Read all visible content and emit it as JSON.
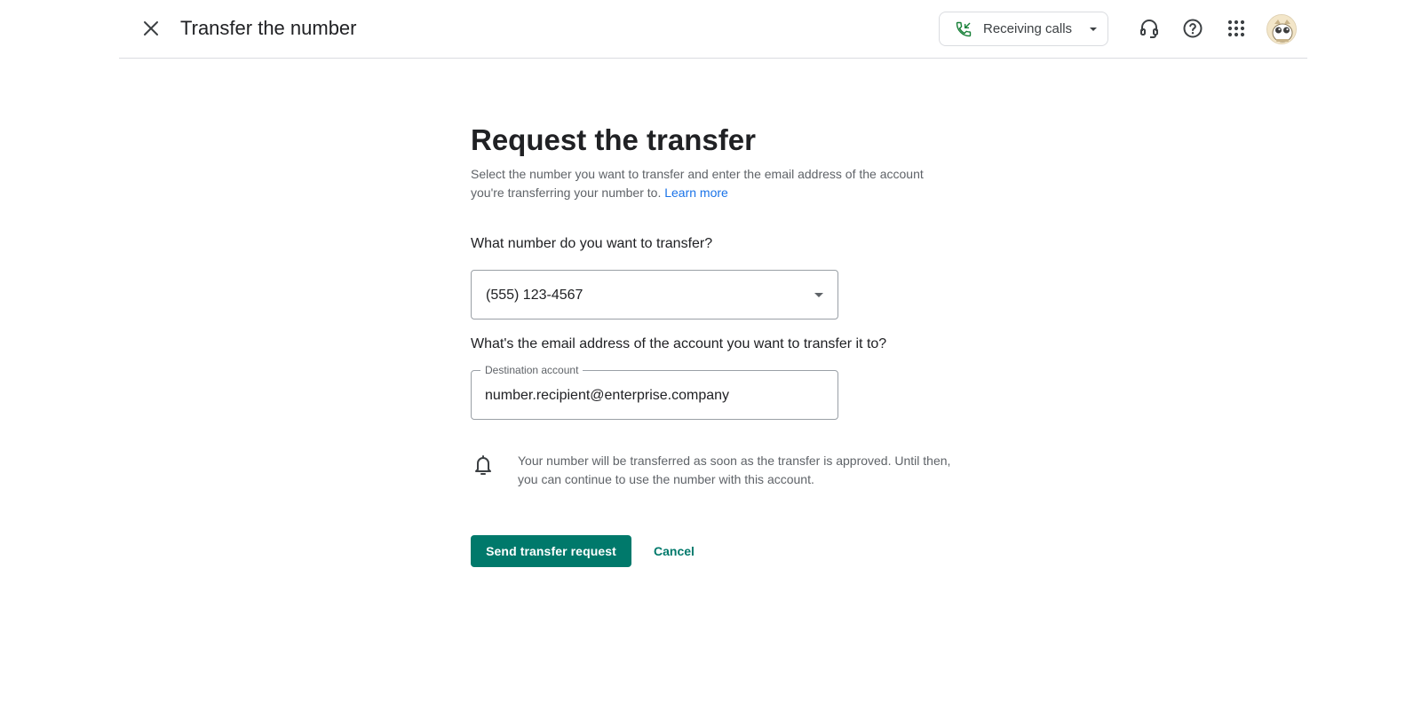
{
  "header": {
    "title": "Transfer the number",
    "close_icon": "close-icon",
    "status_chip": {
      "label": "Receiving calls",
      "icon": "phone-incoming-icon",
      "accent": "#188038"
    },
    "icons": [
      "headset-icon",
      "help-icon",
      "apps-grid-icon"
    ],
    "avatar": "user-avatar"
  },
  "main": {
    "heading": "Request the transfer",
    "description": "Select the number you want to transfer and enter the email address of the account you're transferring your number to.",
    "learn_more": "Learn more",
    "number_question": "What number do you want to transfer?",
    "number_select": {
      "value": "(555) 123-4567"
    },
    "email_question": "What's the email address of the account you want to transfer it to?",
    "destination": {
      "label": "Destination account",
      "value": "number.recipient@enterprise.company"
    },
    "notice": {
      "icon": "bell-icon",
      "text": "Your number will be transferred as soon as the transfer is approved. Until then, you can continue to use the number with this account."
    },
    "actions": {
      "send_label": "Send transfer request",
      "cancel_label": "Cancel"
    }
  },
  "colors": {
    "primary": "#00796b",
    "link": "#1a73e8",
    "divider": "#dadce0"
  }
}
